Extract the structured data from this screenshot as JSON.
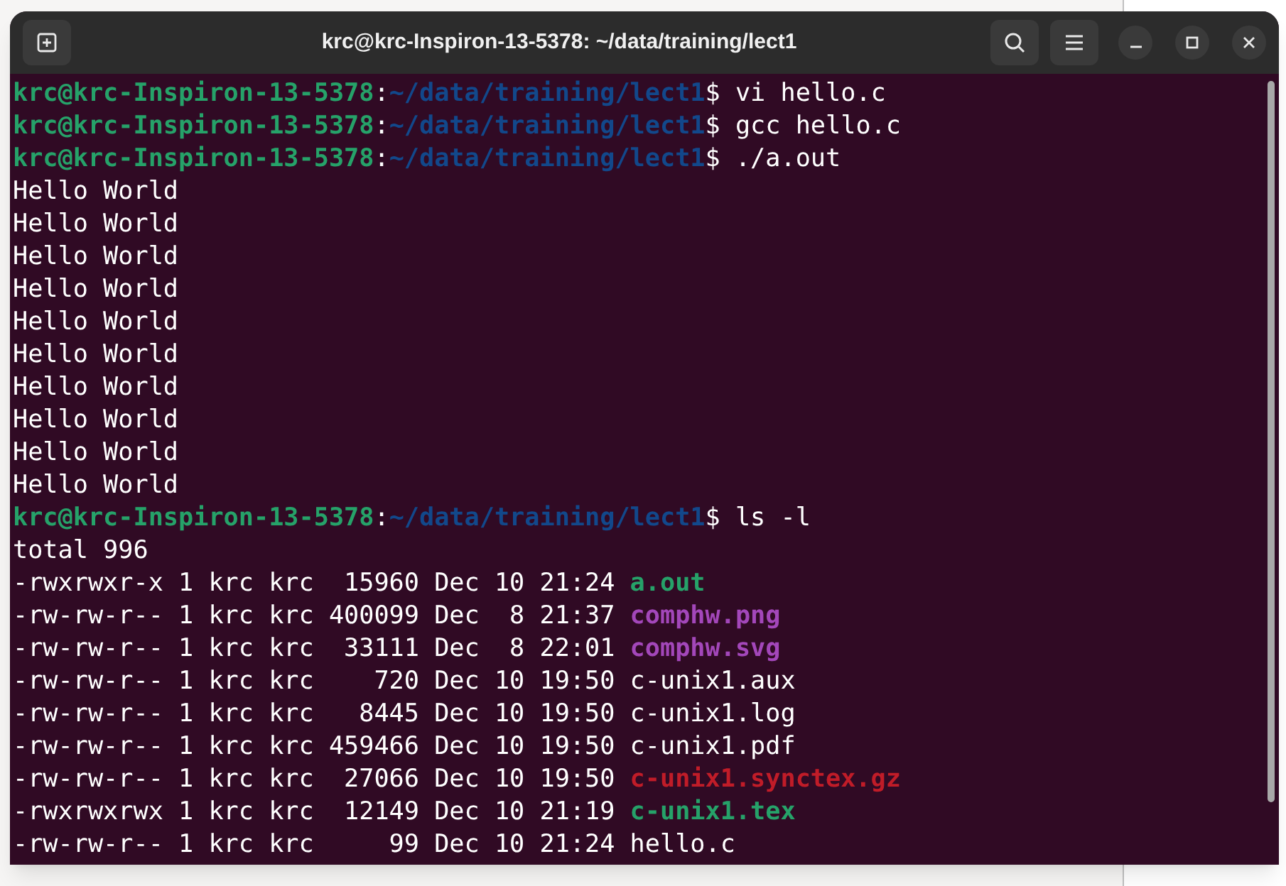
{
  "window": {
    "title": "krc@krc-Inspiron-13-5378: ~/data/training/lect1"
  },
  "lines": [
    {
      "kind": "prompt",
      "user": "krc@krc-Inspiron-13-5378",
      "sep": ":",
      "path": "~/data/training/lect1",
      "command": "$ vi hello.c"
    },
    {
      "kind": "prompt",
      "user": "krc@krc-Inspiron-13-5378",
      "sep": ":",
      "path": "~/data/training/lect1",
      "command": "$ gcc hello.c"
    },
    {
      "kind": "prompt",
      "user": "krc@krc-Inspiron-13-5378",
      "sep": ":",
      "path": "~/data/training/lect1",
      "command": "$ ./a.out"
    },
    {
      "kind": "output",
      "text": "Hello World"
    },
    {
      "kind": "output",
      "text": "Hello World"
    },
    {
      "kind": "output",
      "text": "Hello World"
    },
    {
      "kind": "output",
      "text": "Hello World"
    },
    {
      "kind": "output",
      "text": "Hello World"
    },
    {
      "kind": "output",
      "text": "Hello World"
    },
    {
      "kind": "output",
      "text": "Hello World"
    },
    {
      "kind": "output",
      "text": "Hello World"
    },
    {
      "kind": "output",
      "text": "Hello World"
    },
    {
      "kind": "output",
      "text": "Hello World"
    },
    {
      "kind": "prompt",
      "user": "krc@krc-Inspiron-13-5378",
      "sep": ":",
      "path": "~/data/training/lect1",
      "command": "$ ls -l"
    },
    {
      "kind": "output",
      "text": "total 996"
    },
    {
      "kind": "listing",
      "details": "-rwxrwxr-x 1 krc krc  15960 Dec 10 21:24",
      "name": "a.out",
      "color": "#26a269",
      "bold": true
    },
    {
      "kind": "listing",
      "details": "-rw-rw-r-- 1 krc krc 400099 Dec  8 21:37",
      "name": "comphw.png",
      "color": "#a347ba",
      "bold": true
    },
    {
      "kind": "listing",
      "details": "-rw-rw-r-- 1 krc krc  33111 Dec  8 22:01",
      "name": "comphw.svg",
      "color": "#a347ba",
      "bold": true
    },
    {
      "kind": "listing",
      "details": "-rw-rw-r-- 1 krc krc    720 Dec 10 19:50",
      "name": "c-unix1.aux",
      "color": "#ffffff",
      "bold": false
    },
    {
      "kind": "listing",
      "details": "-rw-rw-r-- 1 krc krc   8445 Dec 10 19:50",
      "name": "c-unix1.log",
      "color": "#ffffff",
      "bold": false
    },
    {
      "kind": "listing",
      "details": "-rw-rw-r-- 1 krc krc 459466 Dec 10 19:50",
      "name": "c-unix1.pdf",
      "color": "#ffffff",
      "bold": false
    },
    {
      "kind": "listing",
      "details": "-rw-rw-r-- 1 krc krc  27066 Dec 10 19:50",
      "name": "c-unix1.synctex.gz",
      "color": "#c01c28",
      "bold": true
    },
    {
      "kind": "listing",
      "details": "-rwxrwxrwx 1 krc krc  12149 Dec 10 21:19",
      "name": "c-unix1.tex",
      "color": "#26a269",
      "bold": true
    },
    {
      "kind": "listing",
      "details": "-rw-rw-r-- 1 krc krc     99 Dec 10 21:24",
      "name": "hello.c",
      "color": "#ffffff",
      "bold": false
    }
  ]
}
